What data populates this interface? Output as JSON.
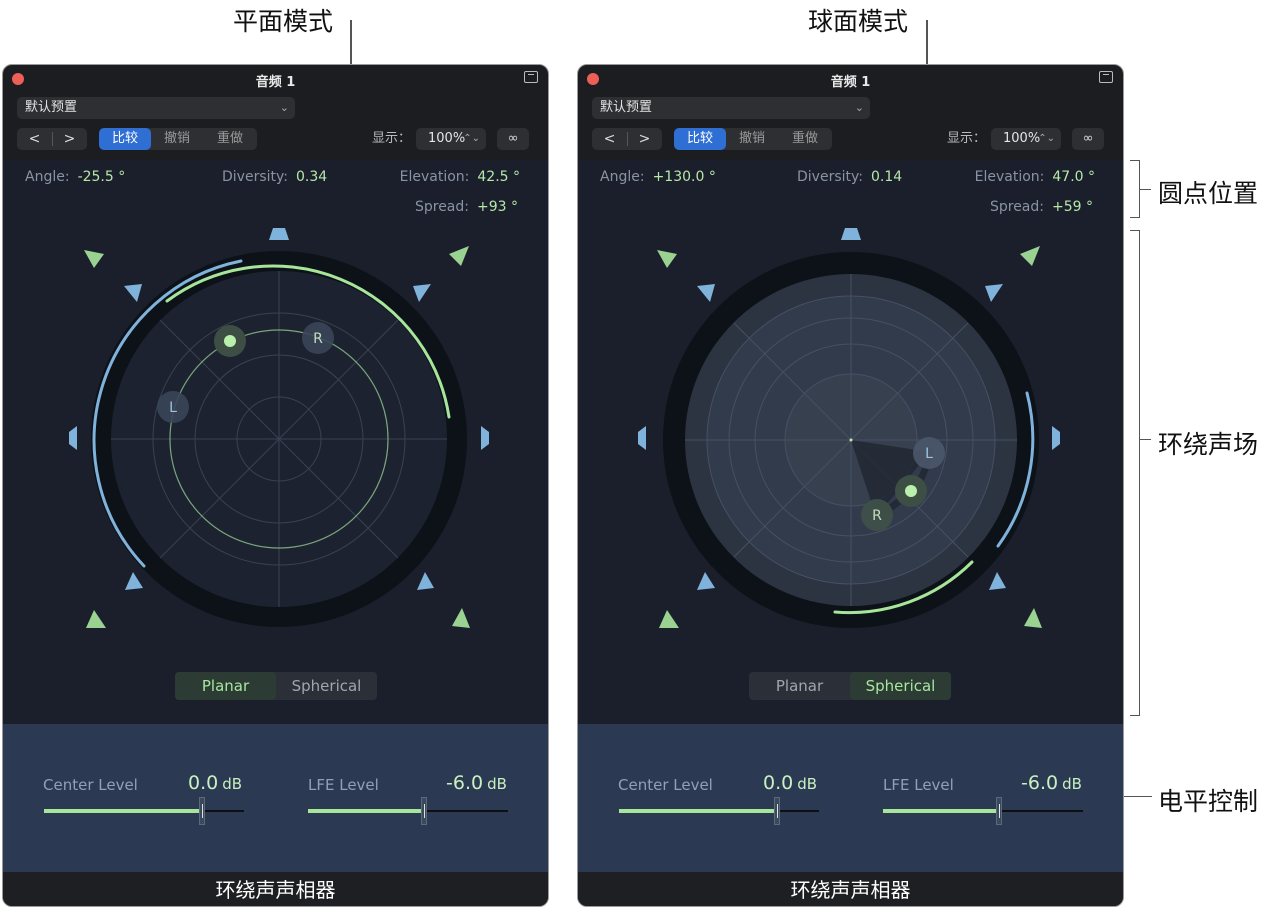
{
  "callouts": {
    "planar_mode": "平面模式",
    "spherical_mode": "球面模式",
    "dot_position": "圆点位置",
    "surround_field": "环绕声场",
    "level_controls": "电平控制"
  },
  "panels": [
    {
      "title": "音频 1",
      "preset": "默认预置",
      "edit_buttons": {
        "compare": "比较",
        "undo": "撤销",
        "redo": "重做"
      },
      "show_label": "显示：",
      "zoom": "100%",
      "params": {
        "angle_label": "Angle:",
        "angle_value": "-25.5 °",
        "diversity_label": "Diversity:",
        "diversity_value": "0.34",
        "elevation_label": "Elevation:",
        "elevation_value": "42.5 °",
        "spread_label": "Spread:",
        "spread_value": "+93 °"
      },
      "field": {
        "left_label": "L",
        "right_label": "R"
      },
      "modes": {
        "planar": "Planar",
        "spherical": "Spherical",
        "active": "Planar"
      },
      "levels": {
        "center_label": "Center Level",
        "center_value": "0.0",
        "center_unit": "dB",
        "center_fill": 0.79,
        "lfe_label": "LFE Level",
        "lfe_value": "-6.0",
        "lfe_unit": "dB",
        "lfe_fill": 0.58
      },
      "caption": "环绕声声相器"
    },
    {
      "title": "音频 1",
      "preset": "默认预置",
      "edit_buttons": {
        "compare": "比较",
        "undo": "撤销",
        "redo": "重做"
      },
      "show_label": "显示：",
      "zoom": "100%",
      "params": {
        "angle_label": "Angle:",
        "angle_value": "+130.0 °",
        "diversity_label": "Diversity:",
        "diversity_value": "0.14",
        "elevation_label": "Elevation:",
        "elevation_value": "47.0 °",
        "spread_label": "Spread:",
        "spread_value": "+59 °"
      },
      "field": {
        "left_label": "L",
        "right_label": "R"
      },
      "modes": {
        "planar": "Planar",
        "spherical": "Spherical",
        "active": "Spherical"
      },
      "levels": {
        "center_label": "Center Level",
        "center_value": "0.0",
        "center_unit": "dB",
        "center_fill": 0.79,
        "lfe_label": "LFE Level",
        "lfe_value": "-6.0",
        "lfe_unit": "dB",
        "lfe_fill": 0.58
      },
      "caption": "环绕声声相器"
    }
  ],
  "colors": {
    "accent_green": "#a6e59a",
    "accent_blue": "#7fb3db",
    "compare_active": "#2f6fd3",
    "close_red": "#ed5f57"
  }
}
